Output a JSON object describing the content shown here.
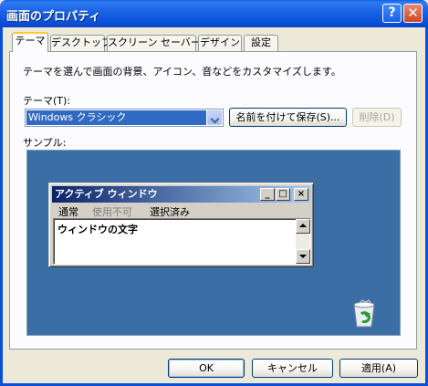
{
  "window": {
    "title": "画面のプロパティ",
    "help_glyph": "?",
    "close_glyph": "✕"
  },
  "tabs": [
    {
      "label": "テーマ",
      "active": true
    },
    {
      "label": "デスクトップ",
      "active": false
    },
    {
      "label": "スクリーン セーバー",
      "active": false
    },
    {
      "label": "デザイン",
      "active": false
    },
    {
      "label": "設定",
      "active": false
    }
  ],
  "themes_tab": {
    "description": "テーマを選んで画面の背景、アイコン、音などをカスタマイズします。",
    "theme_label": "テーマ(T):",
    "theme_value": "Windows クラシック",
    "save_as_label": "名前を付けて保存(S)...",
    "delete_label": "削除(D)",
    "sample_label": "サンプル:"
  },
  "preview": {
    "window_title": "アクティブ ウィンドウ",
    "menu": [
      "通常",
      "使用不可",
      "選択済み"
    ],
    "menu_disabled_index": 1,
    "body_text": "ウィンドウの文字",
    "desktop_color": "#3a6ea5",
    "desktop_icon": "recycle-bin-icon"
  },
  "footer": {
    "ok_label": "OK",
    "cancel_label": "キャンセル",
    "apply_label": "適用(A)"
  }
}
